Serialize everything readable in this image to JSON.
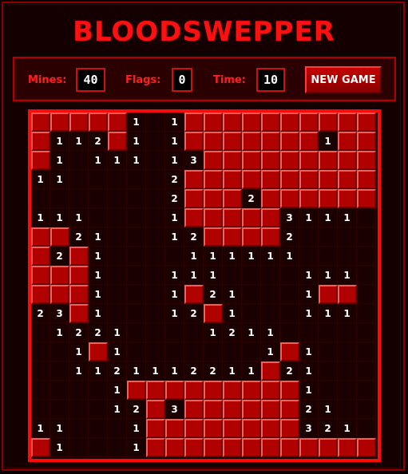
{
  "title": "BLOODSWEPPER",
  "status": {
    "mines_label": "Mines:",
    "mines_value": "40",
    "flags_label": "Flags:",
    "flags_value": "0",
    "time_label": "Time:",
    "time_value": "10",
    "new_game_label": "NEW GAME"
  },
  "colors": {
    "accent": "#ff0a0a",
    "hidden_cell": "#b00000",
    "open_cell": "#1a0000",
    "number_text": "#ffffff"
  },
  "board": {
    "rows": 18,
    "cols": 18,
    "legend": "# = unrevealed cell, . = revealed empty, digit = adjacent mine count",
    "grid": [
      "#####1.1##########",
      "#112#1.1#######1##",
      "#1.111.13#########",
      "11.....2##########",
      ".......2###2######",
      "111....1#####3111.",
      "##21...12####2....",
      "#2#1....111111....",
      "###1...111....111.",
      "###1...1#21...1##.",
      "23#1...12#1...111.",
      ".1221....1211.....",
      "..1#1.......1#1...",
      "..1121112211#21...",
      "....1#########1...",
      "....12#3######21..",
      "11...1########321.",
      "#1...1############"
    ]
  }
}
